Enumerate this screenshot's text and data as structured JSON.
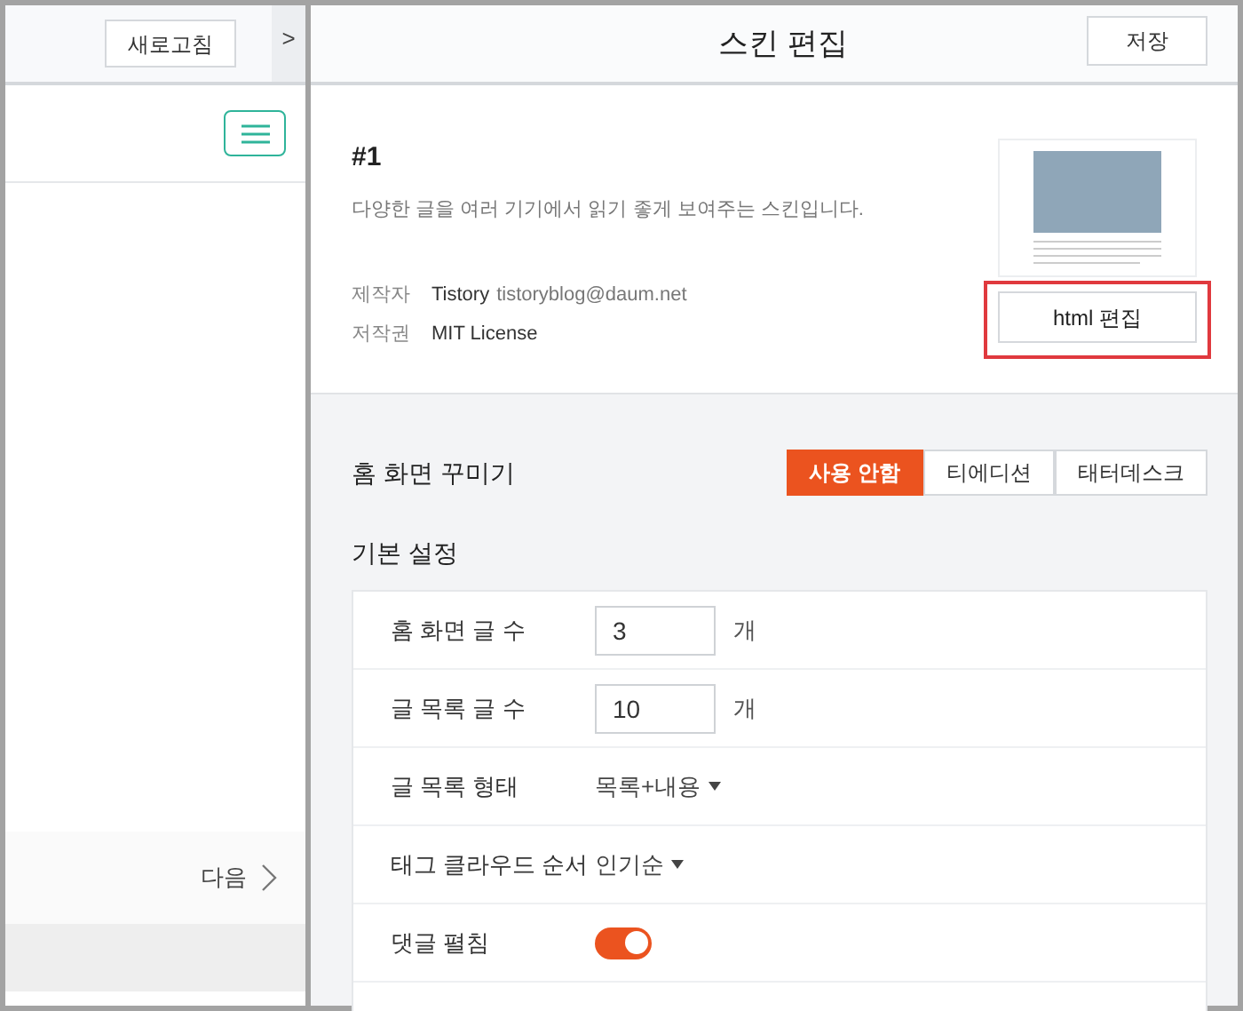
{
  "left_panel": {
    "refresh_button": "새로고침",
    "collapse_toggle": ">",
    "next_link": "다음"
  },
  "header": {
    "title": "스킨 편집",
    "save_button": "저장"
  },
  "skin": {
    "name": "#1",
    "description": "다양한 글을 여러 기기에서 읽기 좋게 보여주는 스킨입니다.",
    "meta": [
      {
        "label": "제작자",
        "value": "Tistory",
        "extra": "tistoryblog@daum.net"
      },
      {
        "label": "저작권",
        "value": "MIT License"
      }
    ],
    "html_edit_button": {
      "label": "html 편집",
      "highlighted": true
    }
  },
  "home_decor": {
    "title": "홈 화면 꾸미기",
    "options": [
      {
        "label": "사용 안함",
        "selected": true
      },
      {
        "label": "티에디션",
        "selected": false
      },
      {
        "label": "태터데스크",
        "selected": false
      }
    ]
  },
  "basic_settings": {
    "title": "기본 설정",
    "rows": [
      {
        "kind": "number",
        "label": "홈 화면 글 수",
        "value": "3",
        "unit": "개"
      },
      {
        "kind": "number",
        "label": "글 목록 글 수",
        "value": "10",
        "unit": "개"
      },
      {
        "kind": "select",
        "label": "글 목록 형태",
        "value": "목록+내용"
      },
      {
        "kind": "select",
        "label": "태그 클라우드 순서",
        "value": "인기순"
      },
      {
        "kind": "toggle",
        "label": "댓글 펼침",
        "on": true
      }
    ]
  }
}
